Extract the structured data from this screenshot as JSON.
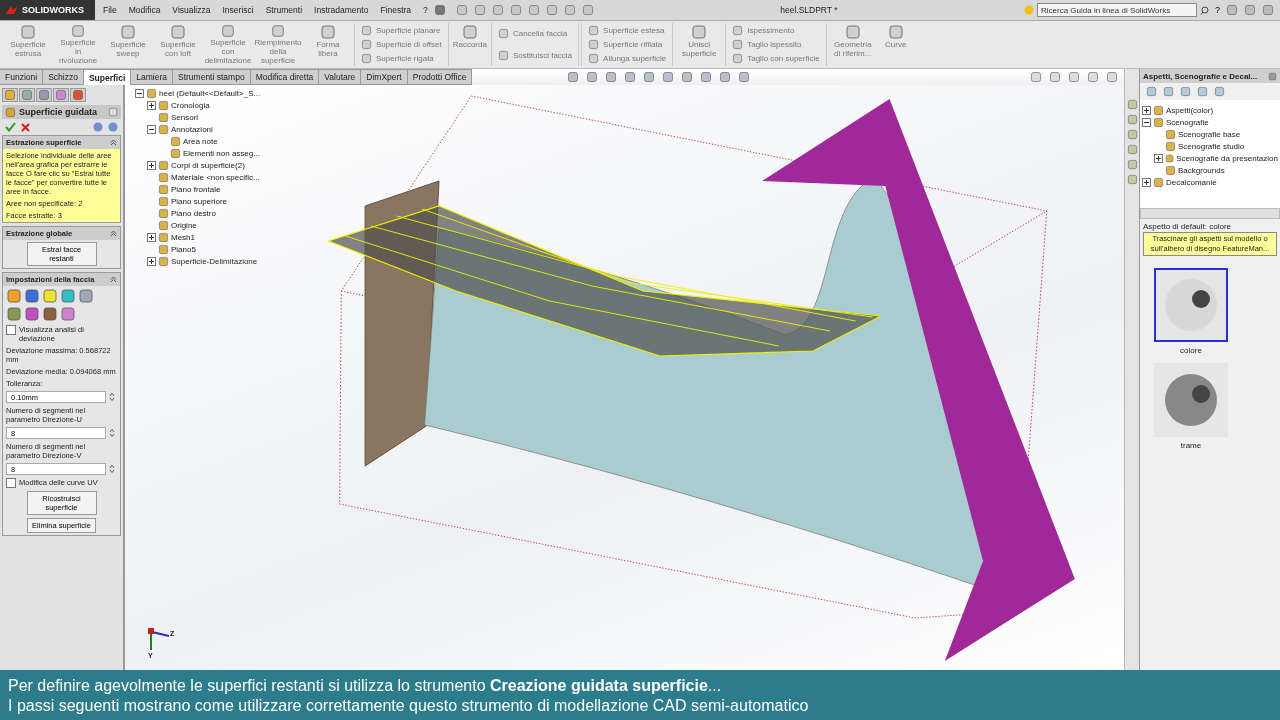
{
  "app": {
    "logo": "SOLIDWORKS",
    "menu": [
      "File",
      "Modifica",
      "Visualizza",
      "Inserisci",
      "Strumenti",
      "Instradamento",
      "Finestra",
      "?"
    ],
    "document_title": "heel.SLDPRT *",
    "search": {
      "placeholder": "Ricerca Guida in linea di SolidWorks"
    },
    "help": "?"
  },
  "ribbon": {
    "groups": [
      {
        "kind": "large",
        "label": "Superficie estrusa"
      },
      {
        "kind": "large",
        "label": "Superficie in rivoluzione"
      },
      {
        "kind": "large",
        "label": "Superficie sweep"
      },
      {
        "kind": "large",
        "label": "Superficie con loft"
      },
      {
        "kind": "large",
        "label": "Superficie con delimitazione"
      },
      {
        "kind": "large",
        "label": "Riempimento della superficie"
      },
      {
        "kind": "large",
        "label": "Forma libera"
      },
      {
        "kind": "stack",
        "items": [
          "Superficie planare",
          "Superficie di offset",
          "Superficie rigata"
        ]
      },
      {
        "kind": "large",
        "label": "Raccorda"
      },
      {
        "kind": "stack",
        "items": [
          "Cancella faccia",
          "Sostituisci faccia"
        ]
      },
      {
        "kind": "stack",
        "items": [
          "Superficie estesa",
          "Superficie rifilata",
          "Allunga superficie"
        ]
      },
      {
        "kind": "large",
        "label": "Unisci superficie"
      },
      {
        "kind": "stack",
        "items": [
          "Ispessimento",
          "Taglio ispessito",
          "Taglio con superficie"
        ]
      },
      {
        "kind": "large",
        "label": "Geometria di riferim..."
      },
      {
        "kind": "large",
        "label": "Curve"
      }
    ]
  },
  "tabs": [
    {
      "label": "Funzioni",
      "selected": false
    },
    {
      "label": "Schizzo",
      "selected": false
    },
    {
      "label": "Superfici",
      "selected": true
    },
    {
      "label": "Lamiera",
      "selected": false
    },
    {
      "label": "Strumenti stampo",
      "selected": false
    },
    {
      "label": "Modifica diretta",
      "selected": false
    },
    {
      "label": "Valutare",
      "selected": false
    },
    {
      "label": "DimXpert",
      "selected": false
    },
    {
      "label": "Prodotti Office",
      "selected": false
    }
  ],
  "property_manager": {
    "title": "Superficie guidata",
    "sections": [
      {
        "title": "Estrazione superficie",
        "items": [
          {
            "kind": "note",
            "text": "Selezione individuale delle aree nell'area grafica per estrarre le facce O fare clic su \"Estrai tutte le facce\" per convertire tutte le aree in facce."
          },
          {
            "kind": "note",
            "text": "Aree non specificate: 2"
          },
          {
            "kind": "note",
            "text": "Facce estratte: 3"
          }
        ]
      },
      {
        "title": "Estrazione globale",
        "items": [
          {
            "kind": "button",
            "text": "Estrai facce restanti"
          }
        ]
      },
      {
        "title": "Impostazioni della faccia",
        "items": [
          {
            "kind": "icons"
          },
          {
            "kind": "checkbox",
            "text": "Visualizza analisi di deviazione",
            "checked": false
          },
          {
            "kind": "text",
            "text": "Deviazione massima: 0.568722 mm"
          },
          {
            "kind": "text",
            "text": "Deviazione media: 0.094068  mm"
          },
          {
            "kind": "text",
            "text": "Tolleranza:"
          },
          {
            "kind": "field",
            "text": "0.10mm"
          },
          {
            "kind": "text",
            "text": "Numero di segmenti nel parametro Direzione-U"
          },
          {
            "kind": "field",
            "text": "8"
          },
          {
            "kind": "text",
            "text": "Numero di segmenti nel parametro Direzione-V"
          },
          {
            "kind": "field",
            "text": "8"
          },
          {
            "kind": "checkbox",
            "text": "Modifica delle curve UV",
            "checked": false
          },
          {
            "kind": "button",
            "text": "Ricostruisci superficie"
          },
          {
            "kind": "button",
            "text": "Elimina superficie"
          }
        ]
      }
    ]
  },
  "feature_tree": {
    "label": "heel  (Default<<Default>_S...",
    "expanded": true,
    "children": [
      {
        "label": "Cronologia",
        "expanded": false
      },
      {
        "label": "Sensori"
      },
      {
        "label": "Annotazioni",
        "expanded": true,
        "children": [
          {
            "label": "Area note"
          },
          {
            "label": "Elementi non asseg..."
          }
        ]
      },
      {
        "label": "Corpi di superficie(2)",
        "expanded": false
      },
      {
        "label": "Materiale <non specific..."
      },
      {
        "label": "Piano frontale"
      },
      {
        "label": "Piano superiore"
      },
      {
        "label": "Piano destro"
      },
      {
        "label": "Origine"
      },
      {
        "label": "Mesh1",
        "expanded": false
      },
      {
        "label": "Piano5"
      },
      {
        "label": "Superficie-Delimitazione",
        "expanded": false
      }
    ]
  },
  "viewport": {
    "triad_labels": [
      "Z",
      "Y"
    ]
  },
  "task_pane": {
    "title": "Aspetti, Scenografie e Decal...",
    "tree": [
      {
        "label": "Aspetti(color)",
        "expanded": false
      },
      {
        "label": "Scenografie",
        "expanded": true,
        "children": [
          {
            "label": "Scenografie base"
          },
          {
            "label": "Scenografie studio"
          },
          {
            "label": "Scenografie da presentazion",
            "expanded": false
          },
          {
            "label": "Backgrounds"
          }
        ]
      },
      {
        "label": "Decalcomanie",
        "expanded": false
      }
    ],
    "default_label": "Aspetto di default: colore",
    "hint": "Trascinare gli aspetti sul modello o sull'albero di disegno FeatureMan...",
    "thumbnails": [
      {
        "label": "colore",
        "selected": true
      },
      {
        "label": "trame",
        "selected": false
      }
    ]
  },
  "caption": {
    "lines": [
      "Per definire agevolmente le superfici restanti si utilizza lo strumento **Creazione guidata superficie**...",
      "I passi seguenti mostrano come utilizzare correttamente questo strumento di modellazione CAD semi-automatico"
    ]
  }
}
